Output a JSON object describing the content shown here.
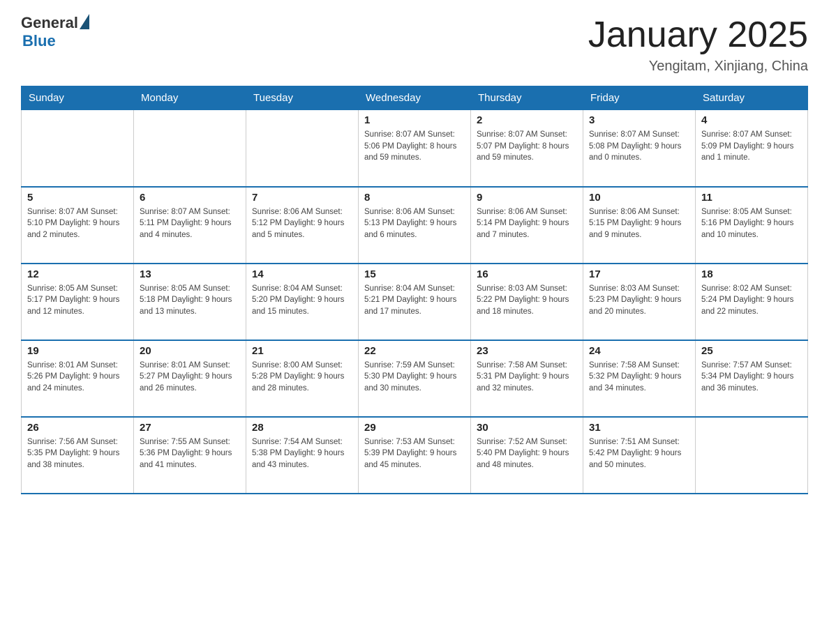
{
  "logo": {
    "general": "General",
    "blue": "Blue"
  },
  "title": "January 2025",
  "subtitle": "Yengitam, Xinjiang, China",
  "days_of_week": [
    "Sunday",
    "Monday",
    "Tuesday",
    "Wednesday",
    "Thursday",
    "Friday",
    "Saturday"
  ],
  "weeks": [
    [
      {
        "day": "",
        "info": ""
      },
      {
        "day": "",
        "info": ""
      },
      {
        "day": "",
        "info": ""
      },
      {
        "day": "1",
        "info": "Sunrise: 8:07 AM\nSunset: 5:06 PM\nDaylight: 8 hours\nand 59 minutes."
      },
      {
        "day": "2",
        "info": "Sunrise: 8:07 AM\nSunset: 5:07 PM\nDaylight: 8 hours\nand 59 minutes."
      },
      {
        "day": "3",
        "info": "Sunrise: 8:07 AM\nSunset: 5:08 PM\nDaylight: 9 hours\nand 0 minutes."
      },
      {
        "day": "4",
        "info": "Sunrise: 8:07 AM\nSunset: 5:09 PM\nDaylight: 9 hours\nand 1 minute."
      }
    ],
    [
      {
        "day": "5",
        "info": "Sunrise: 8:07 AM\nSunset: 5:10 PM\nDaylight: 9 hours\nand 2 minutes."
      },
      {
        "day": "6",
        "info": "Sunrise: 8:07 AM\nSunset: 5:11 PM\nDaylight: 9 hours\nand 4 minutes."
      },
      {
        "day": "7",
        "info": "Sunrise: 8:06 AM\nSunset: 5:12 PM\nDaylight: 9 hours\nand 5 minutes."
      },
      {
        "day": "8",
        "info": "Sunrise: 8:06 AM\nSunset: 5:13 PM\nDaylight: 9 hours\nand 6 minutes."
      },
      {
        "day": "9",
        "info": "Sunrise: 8:06 AM\nSunset: 5:14 PM\nDaylight: 9 hours\nand 7 minutes."
      },
      {
        "day": "10",
        "info": "Sunrise: 8:06 AM\nSunset: 5:15 PM\nDaylight: 9 hours\nand 9 minutes."
      },
      {
        "day": "11",
        "info": "Sunrise: 8:05 AM\nSunset: 5:16 PM\nDaylight: 9 hours\nand 10 minutes."
      }
    ],
    [
      {
        "day": "12",
        "info": "Sunrise: 8:05 AM\nSunset: 5:17 PM\nDaylight: 9 hours\nand 12 minutes."
      },
      {
        "day": "13",
        "info": "Sunrise: 8:05 AM\nSunset: 5:18 PM\nDaylight: 9 hours\nand 13 minutes."
      },
      {
        "day": "14",
        "info": "Sunrise: 8:04 AM\nSunset: 5:20 PM\nDaylight: 9 hours\nand 15 minutes."
      },
      {
        "day": "15",
        "info": "Sunrise: 8:04 AM\nSunset: 5:21 PM\nDaylight: 9 hours\nand 17 minutes."
      },
      {
        "day": "16",
        "info": "Sunrise: 8:03 AM\nSunset: 5:22 PM\nDaylight: 9 hours\nand 18 minutes."
      },
      {
        "day": "17",
        "info": "Sunrise: 8:03 AM\nSunset: 5:23 PM\nDaylight: 9 hours\nand 20 minutes."
      },
      {
        "day": "18",
        "info": "Sunrise: 8:02 AM\nSunset: 5:24 PM\nDaylight: 9 hours\nand 22 minutes."
      }
    ],
    [
      {
        "day": "19",
        "info": "Sunrise: 8:01 AM\nSunset: 5:26 PM\nDaylight: 9 hours\nand 24 minutes."
      },
      {
        "day": "20",
        "info": "Sunrise: 8:01 AM\nSunset: 5:27 PM\nDaylight: 9 hours\nand 26 minutes."
      },
      {
        "day": "21",
        "info": "Sunrise: 8:00 AM\nSunset: 5:28 PM\nDaylight: 9 hours\nand 28 minutes."
      },
      {
        "day": "22",
        "info": "Sunrise: 7:59 AM\nSunset: 5:30 PM\nDaylight: 9 hours\nand 30 minutes."
      },
      {
        "day": "23",
        "info": "Sunrise: 7:58 AM\nSunset: 5:31 PM\nDaylight: 9 hours\nand 32 minutes."
      },
      {
        "day": "24",
        "info": "Sunrise: 7:58 AM\nSunset: 5:32 PM\nDaylight: 9 hours\nand 34 minutes."
      },
      {
        "day": "25",
        "info": "Sunrise: 7:57 AM\nSunset: 5:34 PM\nDaylight: 9 hours\nand 36 minutes."
      }
    ],
    [
      {
        "day": "26",
        "info": "Sunrise: 7:56 AM\nSunset: 5:35 PM\nDaylight: 9 hours\nand 38 minutes."
      },
      {
        "day": "27",
        "info": "Sunrise: 7:55 AM\nSunset: 5:36 PM\nDaylight: 9 hours\nand 41 minutes."
      },
      {
        "day": "28",
        "info": "Sunrise: 7:54 AM\nSunset: 5:38 PM\nDaylight: 9 hours\nand 43 minutes."
      },
      {
        "day": "29",
        "info": "Sunrise: 7:53 AM\nSunset: 5:39 PM\nDaylight: 9 hours\nand 45 minutes."
      },
      {
        "day": "30",
        "info": "Sunrise: 7:52 AM\nSunset: 5:40 PM\nDaylight: 9 hours\nand 48 minutes."
      },
      {
        "day": "31",
        "info": "Sunrise: 7:51 AM\nSunset: 5:42 PM\nDaylight: 9 hours\nand 50 minutes."
      },
      {
        "day": "",
        "info": ""
      }
    ]
  ]
}
